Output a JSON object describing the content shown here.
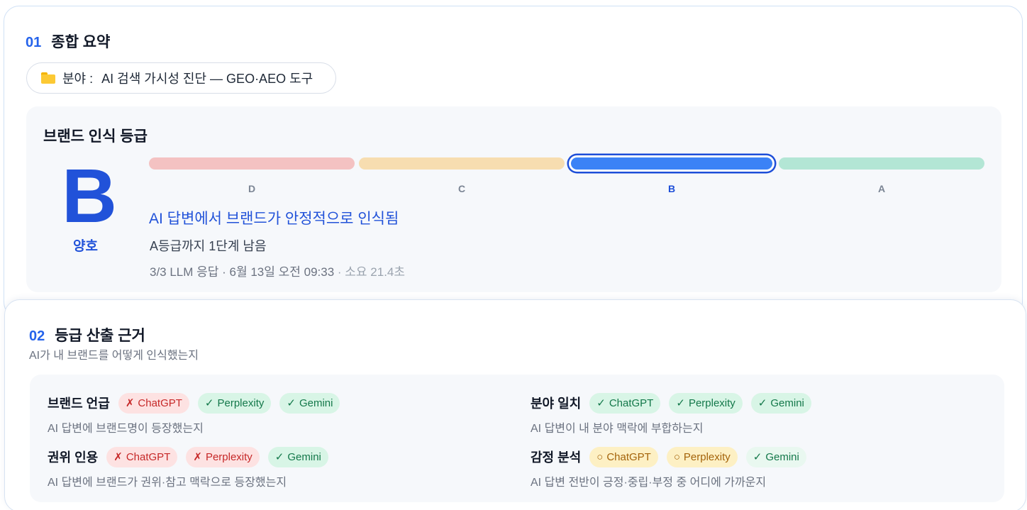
{
  "summary": {
    "num": "01",
    "title": "종합 요약",
    "field_label": "분야 :",
    "field_value": "AI 검색 가시성 진단 — GEO·AEO 도구"
  },
  "grade": {
    "panel_title": "브랜드 인식 등급",
    "letter": "B",
    "word": "양호",
    "scale": [
      {
        "label": "D",
        "color": "#f4c2c2",
        "active": false
      },
      {
        "label": "C",
        "color": "#f7ddb0",
        "active": false
      },
      {
        "label": "B",
        "color": "#3b82f6",
        "active": true
      },
      {
        "label": "A",
        "color": "#b3e6d5",
        "active": false
      }
    ],
    "headline": "AI 답변에서 브랜드가 안정적으로 인식됨",
    "remaining": "A등급까지 1단계 남음",
    "meta_main": "3/3 LLM 응답 · 6월 13일 오전 09:33",
    "meta_dim": " · 소요 21.4초"
  },
  "basis": {
    "num": "02",
    "title": "등급 산출 근거",
    "subtitle": "AI가 내 브랜드를 어떻게 인식했는지",
    "items": [
      {
        "label": "브랜드 언급",
        "desc": "AI 답변에 브랜드명이 등장했는지",
        "chips": [
          {
            "mark": "✗",
            "text": "ChatGPT",
            "status": "bad"
          },
          {
            "mark": "✓",
            "text": "Perplexity",
            "status": "ok"
          },
          {
            "mark": "✓",
            "text": "Gemini",
            "status": "ok"
          }
        ]
      },
      {
        "label": "분야 일치",
        "desc": "AI 답변이 내 분야 맥락에 부합하는지",
        "chips": [
          {
            "mark": "✓",
            "text": "ChatGPT",
            "status": "ok"
          },
          {
            "mark": "✓",
            "text": "Perplexity",
            "status": "ok"
          },
          {
            "mark": "✓",
            "text": "Gemini",
            "status": "ok"
          }
        ]
      },
      {
        "label": "권위 인용",
        "desc": "AI 답변에 브랜드가 권위·참고 맥락으로 등장했는지",
        "chips": [
          {
            "mark": "✗",
            "text": "ChatGPT",
            "status": "bad"
          },
          {
            "mark": "✗",
            "text": "Perplexity",
            "status": "bad"
          },
          {
            "mark": "✓",
            "text": "Gemini",
            "status": "ok"
          }
        ]
      },
      {
        "label": "감정 분석",
        "desc": "AI 답변 전반이 긍정·중립·부정 중 어디에 가까운지",
        "chips": [
          {
            "mark": "○",
            "text": "ChatGPT",
            "status": "mid"
          },
          {
            "mark": "○",
            "text": "Perplexity",
            "status": "mid"
          },
          {
            "mark": "✓",
            "text": "Gemini",
            "status": "soft"
          }
        ]
      }
    ]
  }
}
